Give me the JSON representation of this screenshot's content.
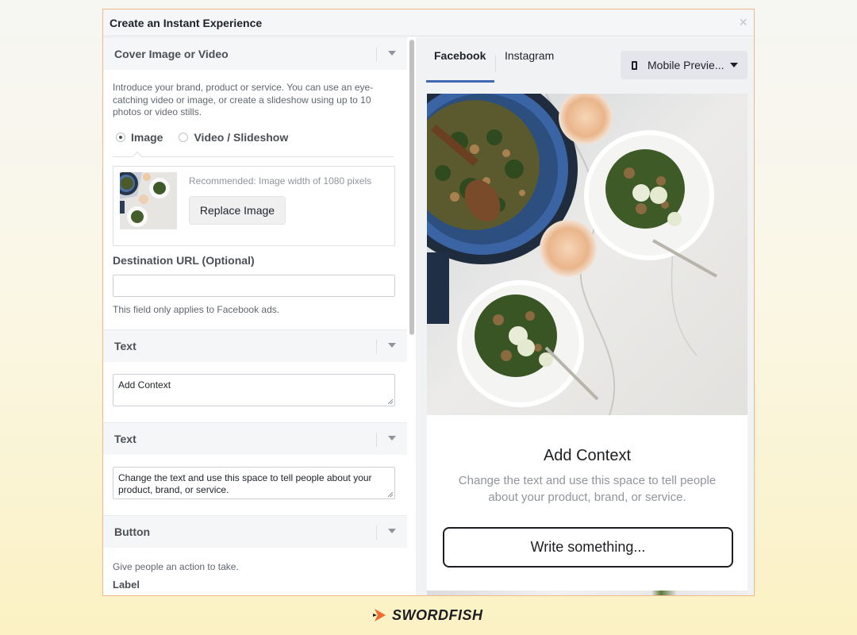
{
  "dialog": {
    "title": "Create an Instant Experience",
    "close_glyph": "×"
  },
  "cover": {
    "heading": "Cover Image or Video",
    "description": "Introduce your brand, product or service. You can use an eye-catching video or image, or create a slideshow using up to 10 photos or video stills.",
    "options": [
      {
        "label": "Image",
        "selected": true
      },
      {
        "label": "Video / Slideshow",
        "selected": false
      }
    ],
    "recommendation": "Recommended: Image width of 1080 pixels",
    "replace_label": "Replace Image",
    "destination_label": "Destination URL (Optional)",
    "destination_value": "",
    "destination_note": "This field only applies to Facebook ads."
  },
  "text_1": {
    "heading": "Text",
    "value": "Add Context"
  },
  "text_2": {
    "heading": "Text",
    "value": "Change the text and use this space to tell people about your product, brand, or service."
  },
  "button_section": {
    "heading": "Button",
    "description": "Give people an action to take.",
    "label_heading": "Label"
  },
  "preview": {
    "tabs": [
      {
        "label": "Facebook",
        "active": true
      },
      {
        "label": "Instagram",
        "active": false
      }
    ],
    "device_label": "Mobile Previe...",
    "card_title": "Add Context",
    "card_description": "Change the text and use this space to tell people about your product, brand, or service.",
    "button_label": "Write something..."
  },
  "branding": {
    "name": "SWORDFISH",
    "accent": "#f26b2a"
  },
  "colors": {
    "link_blue": "#4267b2",
    "dialog_border": "#f3b58a"
  }
}
